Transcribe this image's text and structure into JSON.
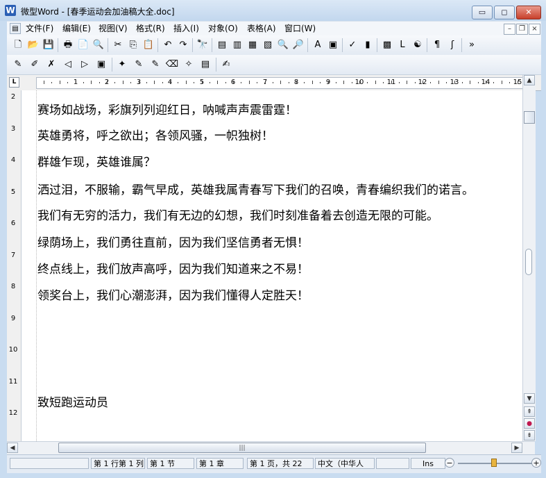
{
  "window": {
    "title": "微型Word - [春季运动会加油稿大全.doc]",
    "app_icon": "W",
    "buttons": {
      "minimize": "▭",
      "maximize": "◻",
      "close": "✕"
    }
  },
  "menu": {
    "items": [
      "文件(F)",
      "编辑(E)",
      "视图(V)",
      "格式(R)",
      "插入(I)",
      "对象(O)",
      "表格(A)",
      "窗口(W)"
    ],
    "mdi_buttons": {
      "minimize": "–",
      "restore": "❐",
      "close": "×"
    }
  },
  "toolbar1": {
    "icons": [
      "new-icon",
      "open-icon",
      "save-icon",
      "print-icon",
      "pdf-icon",
      "print-preview-icon",
      "cut-icon",
      "copy-icon",
      "paste-icon",
      "undo-icon",
      "redo-icon",
      "find-icon",
      "page-view-icon",
      "web-view-icon",
      "outline-view-icon",
      "normal-view-icon",
      "zoom-icon",
      "zoom-find-icon",
      "font-color-icon",
      "format-icon",
      "spell-check-icon",
      "columns-icon",
      "tables-icon",
      "line-icon",
      "symbol-icon",
      "paragraph-mark-icon",
      "formula-icon",
      "more-icon"
    ],
    "glyphs": [
      "🗋",
      "📂",
      "💾",
      "🖶",
      "📄",
      "🔍",
      "✂",
      "⎘",
      "📋",
      "↶",
      "↷",
      "🔭",
      "▤",
      "▥",
      "▦",
      "▧",
      "🔍",
      "🔎",
      "A",
      "▣",
      "✓",
      "▮",
      "▩",
      "L",
      "☯",
      "¶",
      "ʃ",
      "»"
    ]
  },
  "toolbar2": {
    "icons": [
      "new-note-icon",
      "edit-note-icon",
      "delete-note-icon",
      "prev-note-icon",
      "next-note-icon",
      "show-notes-icon",
      "highlight-icon",
      "pen-icon",
      "marker-icon",
      "eraser-icon",
      "clear-icon",
      "notebook-icon",
      "review-icon"
    ],
    "glyphs": [
      "✎",
      "✐",
      "✗",
      "◁",
      "▷",
      "▣",
      "✦",
      "✎",
      "✎",
      "⌫",
      "✧",
      "▤",
      "✍"
    ]
  },
  "ruler": {
    "numbers": [
      "1",
      "2",
      "3",
      "4",
      "5",
      "6",
      "7",
      "8",
      "9",
      "10",
      "11",
      "12",
      "13",
      "14",
      "15"
    ],
    "corner": "L"
  },
  "vruler": {
    "numbers": [
      "2",
      "3",
      "4",
      "5",
      "6",
      "7",
      "8",
      "9",
      "10",
      "11",
      "12"
    ]
  },
  "document": {
    "lines": [
      "赛场如战场，彩旗列列迎红日，呐喊声声震雷霆！",
      "英雄勇将，呼之欲出；各领风骚，一帜独树！",
      "群雄乍现，英雄谁属？",
      "洒过泪，不服输，霸气早成，英雄我属青春写下我们的召唤，青春编织我们的诺言。",
      "我们有无穷的活力，我们有无边的幻想，我们时刻准备着去创造无限的可能。",
      "绿荫场上，我们勇往直前，因为我们坚信勇者无惧！",
      "终点线上，我们放声高呼，因为我们知道来之不易！",
      "领奖台上，我们心潮澎湃，因为我们懂得人定胜天！",
      "致短跑运动员"
    ]
  },
  "scroll": {
    "vertical_buttons": {
      "up": "▲",
      "down": "▼",
      "prev_page": "⇞",
      "select_browse": "●",
      "next_page": "⇟"
    },
    "horizontal_buttons": {
      "left": "◀",
      "right": "▶"
    },
    "thumb_grip": "|||"
  },
  "status": {
    "position": "第 1 行第 1 列",
    "section": "第 1 节",
    "chapter": "第 1 章",
    "page": "第 1 页，共 22",
    "language": "中文（中华人",
    "mode": "Ins",
    "zoom_out": "−",
    "zoom_in": "+",
    "zoom_level_fraction": 0.5
  },
  "colors": {
    "title_bar": "#c2d7ee",
    "close_button": "#c8402b",
    "zoom_knob": "#e8b440"
  }
}
